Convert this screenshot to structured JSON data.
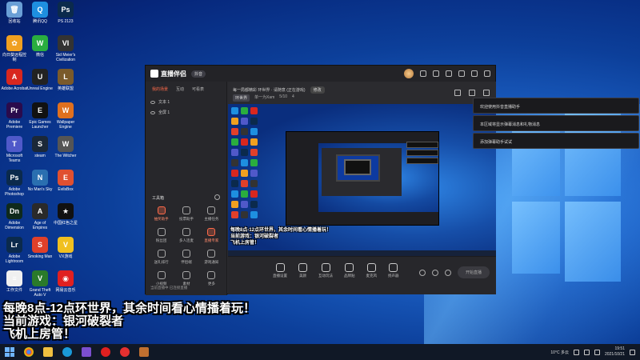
{
  "desktop": {
    "icons": [
      {
        "label": "回收站",
        "color": "#6a9fd6",
        "glyph": "🗑"
      },
      {
        "label": "腾讯QQ",
        "color": "#1e8fe0",
        "glyph": "Q"
      },
      {
        "label": "PS\n2123",
        "color": "#0b2a4c",
        "glyph": "Ps"
      },
      {
        "label": "向日葵远程控制",
        "color": "#f0a020",
        "glyph": "✿"
      },
      {
        "label": "微信",
        "color": "#2aae3f",
        "glyph": "W"
      },
      {
        "label": "Sid Meier's Civilization",
        "color": "#333",
        "glyph": "VI"
      },
      {
        "label": "Adobe Acrobat",
        "color": "#d8271f",
        "glyph": "A"
      },
      {
        "label": "Unreal Engine",
        "color": "#222",
        "glyph": "U"
      },
      {
        "label": "英雄联盟",
        "color": "#7a5a2a",
        "glyph": "L"
      },
      {
        "label": "Adobe Premiere",
        "color": "#2a0b4c",
        "glyph": "Pr"
      },
      {
        "label": "Epic Games Launcher",
        "color": "#111",
        "glyph": "E"
      },
      {
        "label": "Wallpaper Engine",
        "color": "#e0701f",
        "glyph": "W"
      },
      {
        "label": "Microsoft Teams",
        "color": "#5059c9",
        "glyph": "T"
      },
      {
        "label": "steam",
        "color": "#1b2838",
        "glyph": "S"
      },
      {
        "label": "The Witcher",
        "color": "#555",
        "glyph": "W"
      },
      {
        "label": "Adobe Photoshop",
        "color": "#0b2a4c",
        "glyph": "Ps"
      },
      {
        "label": "No Man's Sky",
        "color": "#2a6fb0",
        "glyph": "N"
      },
      {
        "label": "EvilsBox",
        "color": "#e05030",
        "glyph": "E"
      },
      {
        "label": "Adobe Dimension",
        "color": "#0f2a1c",
        "glyph": "Dn"
      },
      {
        "label": "Age of Empires",
        "color": "#2a2a2a",
        "glyph": "A"
      },
      {
        "label": "中国红色之星",
        "color": "#111",
        "glyph": "★"
      },
      {
        "label": "Adobe Lightroom",
        "color": "#0b2a4c",
        "glyph": "Lr"
      },
      {
        "label": "Smoking Man",
        "color": "#e0402a",
        "glyph": "S"
      },
      {
        "label": "VX游戏",
        "color": "#f0c020",
        "glyph": "V"
      },
      {
        "label": "工作文件",
        "color": "#f0f0f0",
        "glyph": "≡"
      },
      {
        "label": "Grand Theft Auto V",
        "color": "#2a7a2a",
        "glyph": "V"
      },
      {
        "label": "网易云音乐",
        "color": "#e02020",
        "glyph": "◉"
      }
    ]
  },
  "app": {
    "name": "直播伴侣",
    "badge": "抖音",
    "left_tabs": [
      "我的场景",
      "互动",
      "可看表"
    ],
    "scenes": [
      "文本 1",
      "全屏 1"
    ],
    "tools_title": "工具箱",
    "tools": [
      {
        "label": "抽奖助手",
        "hot": true
      },
      {
        "label": "投票助手",
        "hot": false
      },
      {
        "label": "主播任务",
        "hot": false
      },
      {
        "label": "粉丝团",
        "hot": false
      },
      {
        "label": "多人连麦",
        "hot": false
      },
      {
        "label": "直播专家",
        "hot": true
      },
      {
        "label": "送礼排行",
        "hot": false
      },
      {
        "label": "伴侣端",
        "hot": false
      },
      {
        "label": "游戏通知",
        "hot": false
      },
      {
        "label": "小视频",
        "hot": false
      },
      {
        "label": "素材",
        "hot": false
      },
      {
        "label": "更多",
        "hot": false
      }
    ],
    "footer_note": "当前直播中 已连接直播",
    "room_title": "每一局都精彩 环世界 · 请随意 (正在游戏)",
    "edit_label": "修改",
    "room_tags": [
      "环世界",
      "单一为Xam",
      "5/10",
      "4"
    ],
    "preview_overlay": [
      "每晚8点-12点环世界，其余时间看心情播着玩！",
      "当前游戏：银河破裂者",
      "飞机上房管！"
    ],
    "controls": [
      "直播设置",
      "美颜",
      "互动玩法",
      "品牌贴",
      "麦克风",
      "扬声器"
    ],
    "live_button": "开始直播"
  },
  "toasts": [
    "欢迎使用抖音直播助手",
    "本区域将显示弹幕消息和礼物消息",
    "添加弹幕助手试试"
  ],
  "overlay": [
    "每晚8点-12点环世界，其余时间看心情播着玩！",
    "当前游戏：银河破裂者",
    "飞机上房管！"
  ],
  "taskbar": {
    "weather": "10°C 多云",
    "time": "19:51",
    "date": "2021/10/21"
  }
}
